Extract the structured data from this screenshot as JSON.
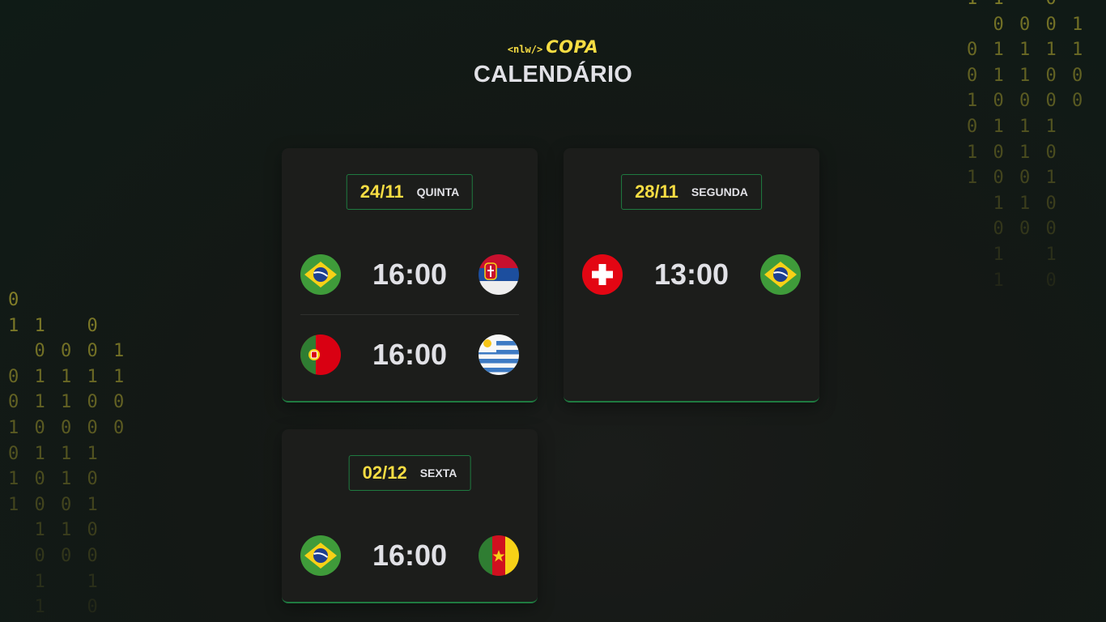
{
  "header": {
    "logo_tag": "<nlw/>",
    "logo_copa": "COPA",
    "title": "CALENDÁRIO"
  },
  "binary_left": [
    "0",
    "11 0",
    " 0001",
    "01111",
    "01100",
    "10000",
    "0111",
    "1010",
    "1001",
    " 110",
    " 000",
    " 1 1",
    " 1 0"
  ],
  "binary_right": [
    "11 0",
    " 0001",
    "01111",
    "01100",
    "10000",
    "0111",
    "1010",
    "1001",
    " 110",
    " 000",
    " 1 1",
    " 1 0"
  ],
  "cards": [
    {
      "date": "24/11",
      "weekday": "QUINTA",
      "matches": [
        {
          "home": "brazil-flag",
          "time": "16:00",
          "away": "serbia-flag"
        },
        {
          "home": "portugal-flag",
          "time": "16:00",
          "away": "uruguay-flag"
        }
      ]
    },
    {
      "date": "28/11",
      "weekday": "SEGUNDA",
      "matches": [
        {
          "home": "switzerland-flag",
          "time": "13:00",
          "away": "brazil-flag"
        }
      ]
    },
    {
      "date": "02/12",
      "weekday": "SEXTA",
      "matches": [
        {
          "home": "brazil-flag",
          "time": "16:00",
          "away": "cameroon-flag"
        }
      ]
    }
  ],
  "colors": {
    "accent": "#f7dd43",
    "border": "#1f7a40",
    "card": "#1c1d1b",
    "text": "#e1e1e6"
  }
}
